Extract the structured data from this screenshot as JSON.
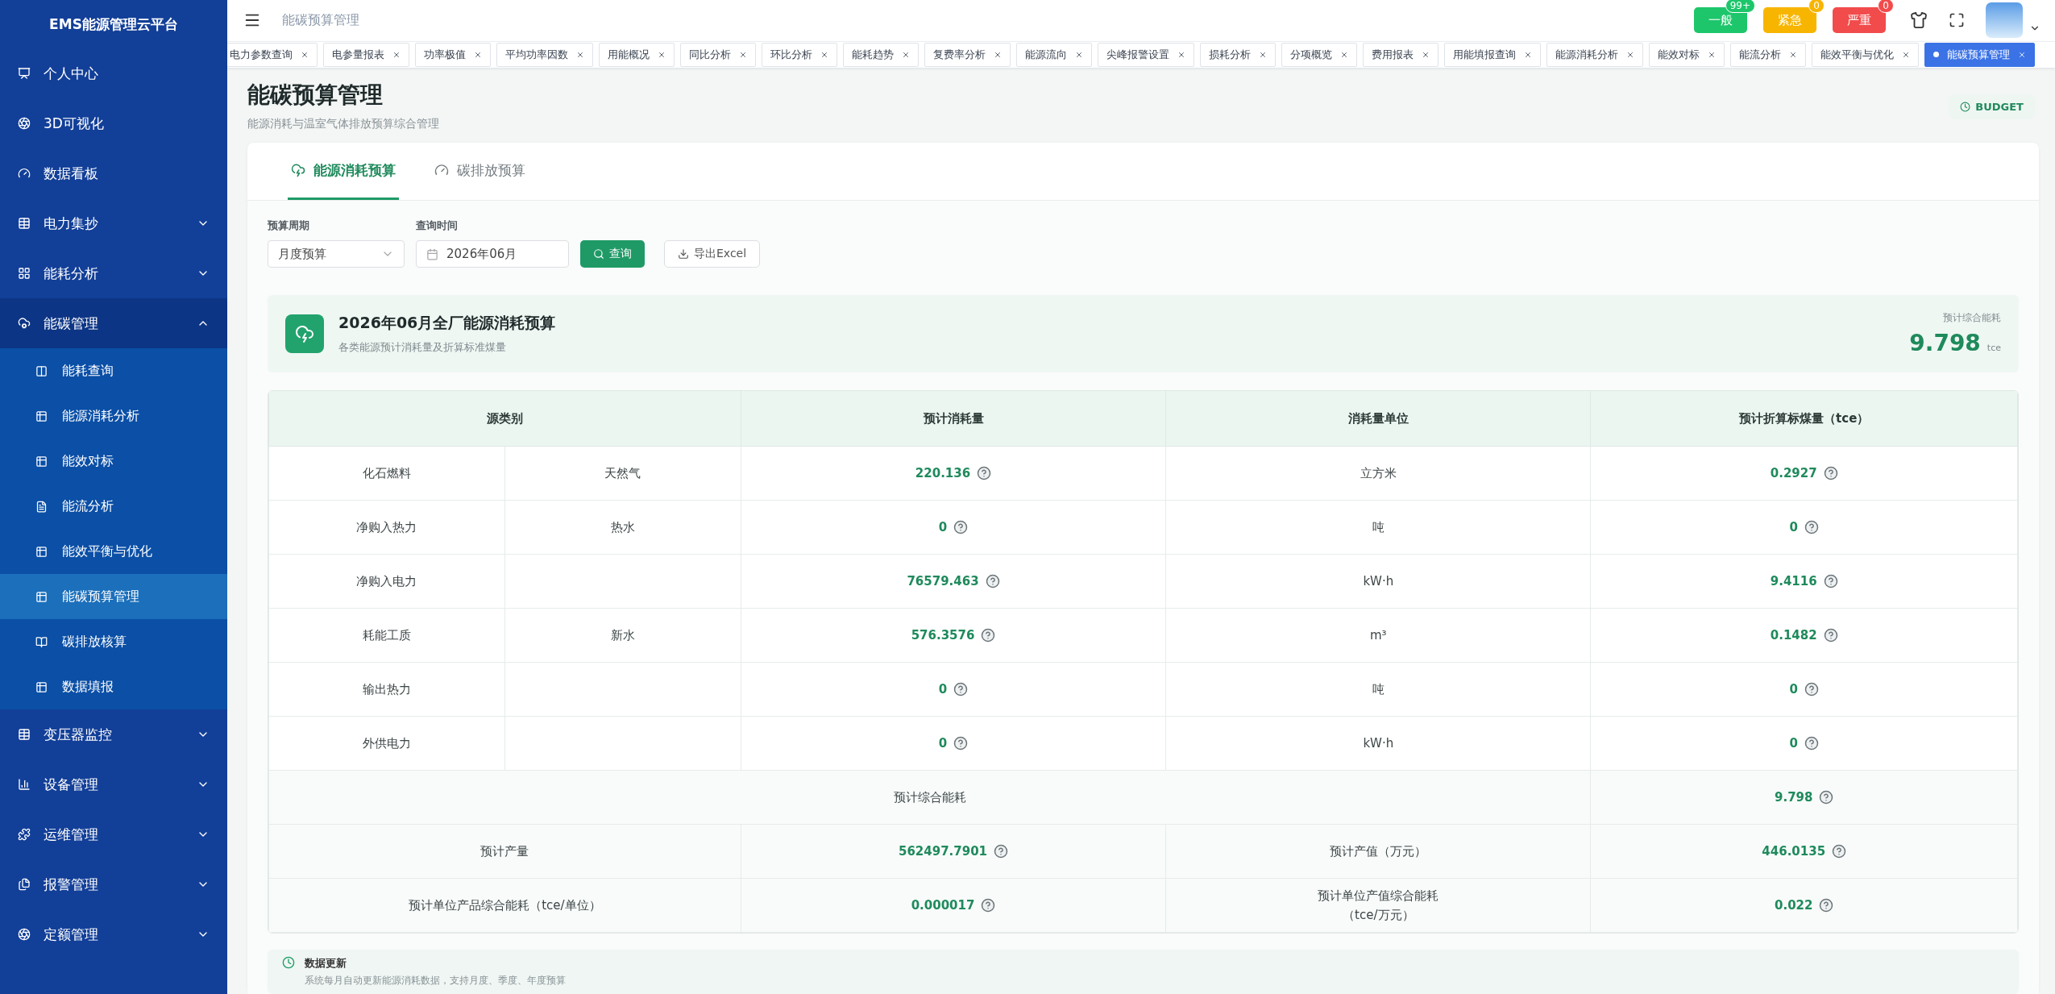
{
  "sidebar": {
    "title": "EMS能源管理云平台",
    "items": [
      {
        "label": "个人中心",
        "has_children": false,
        "expanded": false,
        "selected": false
      },
      {
        "label": "3D可视化",
        "has_children": false,
        "expanded": false,
        "selected": false
      },
      {
        "label": "数据看板",
        "has_children": false,
        "expanded": false,
        "selected": false
      },
      {
        "label": "电力集抄",
        "has_children": true,
        "expanded": false,
        "selected": false
      },
      {
        "label": "能耗分析",
        "has_children": true,
        "expanded": false,
        "selected": false
      },
      {
        "label": "能碳管理",
        "has_children": true,
        "expanded": true,
        "selected": false,
        "children": [
          {
            "label": "能耗查询",
            "selected": false
          },
          {
            "label": "能源消耗分析",
            "selected": false
          },
          {
            "label": "能效对标",
            "selected": false
          },
          {
            "label": "能流分析",
            "selected": false
          },
          {
            "label": "能效平衡与优化",
            "selected": false
          },
          {
            "label": "能碳预算管理",
            "selected": true
          },
          {
            "label": "碳排放核算",
            "selected": false
          },
          {
            "label": "数据填报",
            "selected": false
          }
        ]
      },
      {
        "label": "变压器监控",
        "has_children": true,
        "expanded": false,
        "selected": false
      },
      {
        "label": "设备管理",
        "has_children": true,
        "expanded": false,
        "selected": false
      },
      {
        "label": "运维管理",
        "has_children": true,
        "expanded": false,
        "selected": false
      },
      {
        "label": "报警管理",
        "has_children": true,
        "expanded": false,
        "selected": false
      },
      {
        "label": "定额管理",
        "has_children": true,
        "expanded": false,
        "selected": false
      }
    ]
  },
  "header": {
    "breadcrumb": "能碳预算管理",
    "alerts": [
      {
        "label": "一般",
        "count": "99+",
        "color": "#1dc66b"
      },
      {
        "label": "紧急",
        "count": "0",
        "color": "#f7b500"
      },
      {
        "label": "严重",
        "count": "0",
        "color": "#f24b4b"
      }
    ]
  },
  "tabs": [
    {
      "label": "电力参数查询",
      "selected": false
    },
    {
      "label": "电参量报表",
      "selected": false
    },
    {
      "label": "功率极值",
      "selected": false
    },
    {
      "label": "平均功率因数",
      "selected": false
    },
    {
      "label": "用能概况",
      "selected": false
    },
    {
      "label": "同比分析",
      "selected": false
    },
    {
      "label": "环比分析",
      "selected": false
    },
    {
      "label": "能耗趋势",
      "selected": false
    },
    {
      "label": "复费率分析",
      "selected": false
    },
    {
      "label": "能源流向",
      "selected": false
    },
    {
      "label": "尖峰报警设置",
      "selected": false
    },
    {
      "label": "损耗分析",
      "selected": false
    },
    {
      "label": "分项概览",
      "selected": false
    },
    {
      "label": "费用报表",
      "selected": false
    },
    {
      "label": "用能填报查询",
      "selected": false
    },
    {
      "label": "能源消耗分析",
      "selected": false
    },
    {
      "label": "能效对标",
      "selected": false
    },
    {
      "label": "能流分析",
      "selected": false
    },
    {
      "label": "能效平衡与优化",
      "selected": false
    },
    {
      "label": "能碳预算管理",
      "selected": true
    }
  ],
  "page": {
    "title": "能碳预算管理",
    "subtitle": "能源消耗与温室气体排放预算综合管理",
    "badge": "BUDGET"
  },
  "card_tabs": [
    {
      "label": "能源消耗预算",
      "selected": true
    },
    {
      "label": "碳排放预算",
      "selected": false
    }
  ],
  "filters": {
    "period_label": "预算周期",
    "period_value": "月度预算",
    "time_label": "查询时间",
    "time_value": "2026年06月",
    "query_button": "查询",
    "export_button": "导出Excel"
  },
  "summary": {
    "title": "2026年06月全厂能源消耗预算",
    "subtitle": "各类能源预计消耗量及折算标准煤量",
    "metric_label": "预计综合能耗",
    "metric_value": "9.798",
    "metric_unit": "tce"
  },
  "table": {
    "columns": [
      "源类别",
      "预计消耗量",
      "消耗量单位",
      "预计折算标煤量（tce）"
    ],
    "rows": [
      {
        "category": "化石燃料",
        "subcategory": "天然气",
        "amount": "220.136",
        "unit": "立方米",
        "tce": "0.2927"
      },
      {
        "category": "净购入热力",
        "subcategory": "热水",
        "amount": "0",
        "unit": "吨",
        "tce": "0"
      },
      {
        "category": "净购入电力",
        "amount": "76579.463",
        "unit": "kW·h",
        "tce": "9.4116"
      },
      {
        "category": "耗能工质",
        "subcategory": "新水",
        "amount": "576.3576",
        "unit": "m³",
        "tce": "0.1482"
      },
      {
        "category": "输出热力",
        "amount": "0",
        "unit": "吨",
        "tce": "0"
      },
      {
        "category": "外供电力",
        "amount": "0",
        "unit": "kW·h",
        "tce": "0"
      }
    ],
    "total": {
      "label": "预计综合能耗",
      "value": "9.798"
    },
    "pairs": [
      {
        "label_1": "预计产量",
        "value_1": "562497.7901",
        "label_2": "预计产值（万元）",
        "value_2": "446.0135"
      },
      {
        "label_1": "预计单位产品综合能耗（tce/单位）",
        "value_1": "0.000017",
        "label_2": "预计单位产值综合能耗（tce/万元）",
        "value_2": "0.022"
      }
    ]
  },
  "note": {
    "title": "数据更新",
    "text": "系统每月自动更新能源消耗数据，支持月度、季度、年度预算"
  }
}
